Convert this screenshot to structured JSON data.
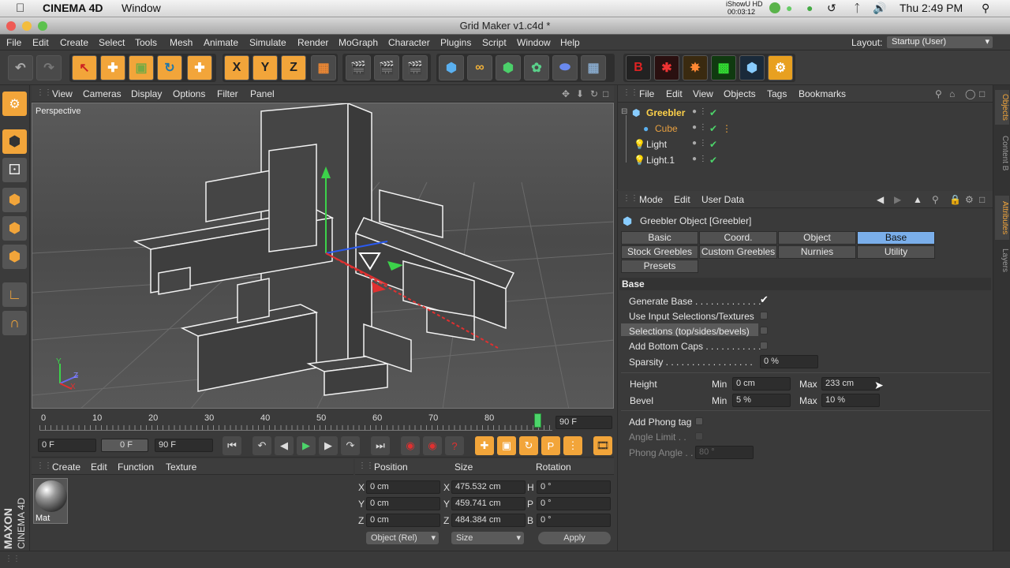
{
  "mac_menubar": {
    "app_name": "CINEMA 4D",
    "window_menu": "Window",
    "ishowu": "iShowU HD",
    "ishowu_time": "00:03:12",
    "clock": "Thu 2:49 PM"
  },
  "window": {
    "title": "Grid Maker v1.c4d *"
  },
  "menu": [
    "File",
    "Edit",
    "Create",
    "Select",
    "Tools",
    "Mesh",
    "Animate",
    "Simulate",
    "Render",
    "MoGraph",
    "Character",
    "Plugins",
    "Script",
    "Window",
    "Help"
  ],
  "layout": {
    "label": "Layout:",
    "value": "Startup (User)"
  },
  "viewport": {
    "menu": [
      "View",
      "Cameras",
      "Display",
      "Options",
      "Filter",
      "Panel"
    ],
    "camera_label": "Perspective",
    "axis_y": "Y",
    "axis_z": "Z",
    "axis_x": "X"
  },
  "timeline": {
    "ticks": [
      "0",
      "10",
      "20",
      "30",
      "40",
      "50",
      "60",
      "70",
      "80"
    ],
    "end_frame": "90 F",
    "playhead": 0.98
  },
  "transport": {
    "start": "0 F",
    "current": "0 F",
    "end": "90 F"
  },
  "material_manager": {
    "menu": [
      "Create",
      "Edit",
      "Function",
      "Texture"
    ],
    "materials": [
      {
        "name": "Mat"
      }
    ]
  },
  "coordinates": {
    "headers": [
      "Position",
      "Size",
      "Rotation"
    ],
    "rows": [
      {
        "axis": "X",
        "pos": "0 cm",
        "size_axis": "X",
        "size": "475.532 cm",
        "rot_axis": "H",
        "rot": "0 °"
      },
      {
        "axis": "Y",
        "pos": "0 cm",
        "size_axis": "Y",
        "size": "459.741 cm",
        "rot_axis": "P",
        "rot": "0 °"
      },
      {
        "axis": "Z",
        "pos": "0 cm",
        "size_axis": "Z",
        "size": "484.384 cm",
        "rot_axis": "B",
        "rot": "0 °"
      }
    ],
    "mode": "Object (Rel)",
    "size_mode": "Size",
    "apply": "Apply"
  },
  "object_manager": {
    "menu": [
      "File",
      "Edit",
      "View",
      "Objects",
      "Tags",
      "Bookmarks"
    ],
    "objects": [
      {
        "name": "Greebler",
        "color": "#ffd24a"
      },
      {
        "name": "Cube",
        "color": "#e8a040"
      },
      {
        "name": "Light",
        "color": "#e6e6e6"
      },
      {
        "name": "Light.1",
        "color": "#e6e6e6"
      }
    ]
  },
  "attributes": {
    "menu": [
      "Mode",
      "Edit",
      "User Data"
    ],
    "object_title": "Greebler Object [Greebler]",
    "tabs": [
      [
        "Basic",
        "Coord.",
        "Object",
        "Base"
      ],
      [
        "Stock Greebles",
        "Custom Greebles",
        "Nurnies",
        "Utility"
      ],
      [
        "Presets"
      ]
    ],
    "active_tab": "Base",
    "section": "Base",
    "params": {
      "generate_base": "Generate Base . . . . . . . . . . . . .",
      "use_input": "Use Input Selections/Textures",
      "selections": "Selections (top/sides/bevels)",
      "add_bottom": "Add Bottom Caps . . . . . . . . . . .",
      "sparsity": "Sparsity . . . . . . . . . . . . . . . . .",
      "sparsity_val": "0 %",
      "height": "Height",
      "bevel": "Bevel",
      "min": "Min",
      "max": "Max",
      "height_min": "0 cm",
      "height_max": "233 cm",
      "bevel_min": "5 %",
      "bevel_max": "10 %",
      "add_phong": "Add Phong tag",
      "angle_limit": "Angle Limit . .",
      "phong_angle": "Phong Angle . .",
      "phong_angle_val": "80 °"
    }
  },
  "side_tabs": [
    "Objects",
    "Content B",
    "Attributes",
    "Layers"
  ],
  "brand": {
    "maxon": "MAXON",
    "product": "CINEMA 4D"
  }
}
